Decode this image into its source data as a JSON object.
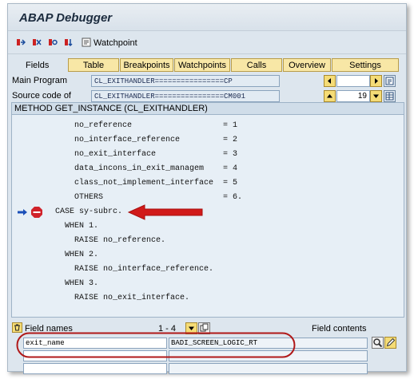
{
  "window": {
    "title": "ABAP Debugger"
  },
  "toolbar": {
    "icons": [
      "breakpoint-set-icon",
      "breakpoint-delete-icon",
      "breakpoint-toggle-icon",
      "watchpoint-icon"
    ],
    "watchpoint_label": "Watchpoint"
  },
  "tabs": {
    "fields_label": "Fields",
    "items": [
      "Table",
      "Breakpoints",
      "Watchpoints",
      "Calls",
      "Overview",
      "Settings"
    ]
  },
  "program": {
    "main_label": "Main Program",
    "main_value": "CL_EXITHANDLER================CP",
    "source_label": "Source code of",
    "source_value": "CL_EXITHANDLER================CM001",
    "line_number": "19"
  },
  "code": {
    "header": "METHOD GET_INSTANCE (CL_EXITHANDLER)",
    "lines": [
      "no_reference                   = 1",
      "no_interface_reference         = 2",
      "no_exit_interface              = 3",
      "data_incons_in_exit_managem    = 4",
      "class_not_implement_interface  = 5",
      "OTHERS                         = 6.",
      "CASE sy-subrc.",
      "WHEN 1.",
      "RAISE no_reference.",
      "WHEN 2.",
      "RAISE no_interface_reference.",
      "WHEN 3.",
      "RAISE no_exit_interface."
    ]
  },
  "fields": {
    "names_label": "Field names",
    "range": "1  -  4",
    "contents_label": "Field contents",
    "rows": [
      {
        "name": "exit_name",
        "content": "BADI_SCREEN_LOGIC_RT"
      },
      {
        "name": "",
        "content": ""
      },
      {
        "name": "",
        "content": ""
      }
    ]
  },
  "colors": {
    "annotation_red": "#d11a1a",
    "tab_yellow": "#f8e7a6",
    "field_blue": "#e2ebf3"
  }
}
